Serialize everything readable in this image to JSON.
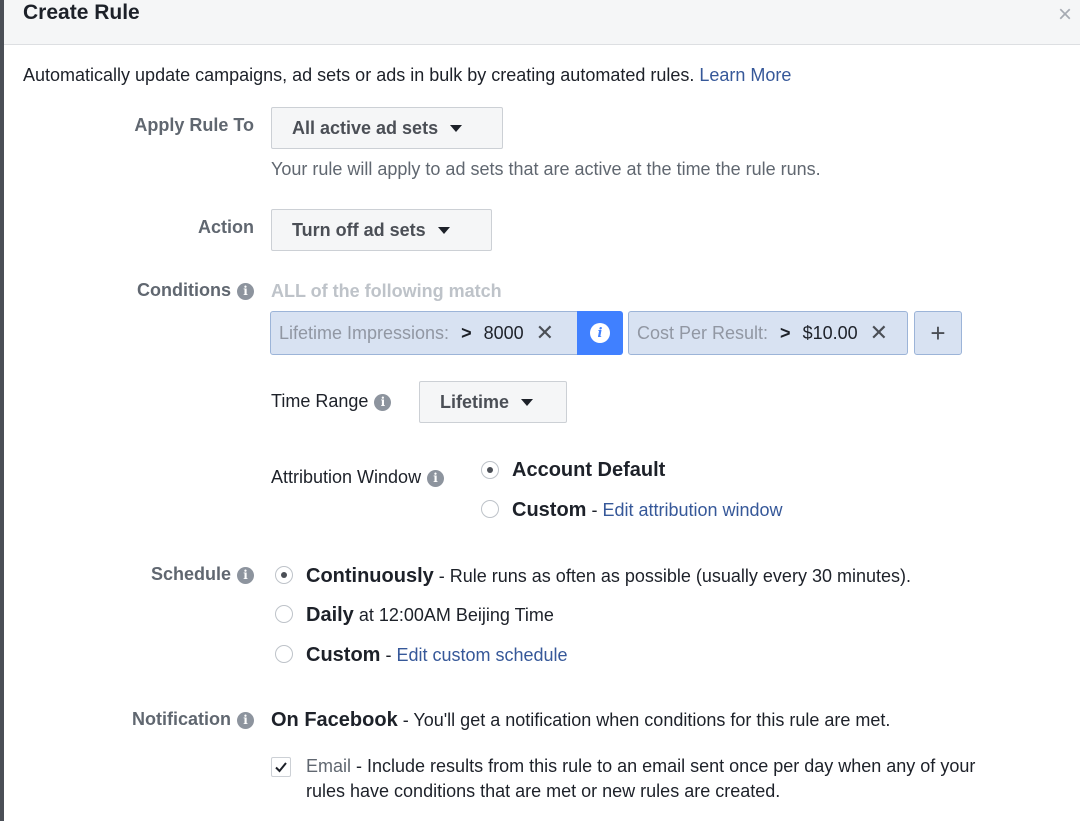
{
  "dialog": {
    "title": "Create Rule",
    "close_icon": "×",
    "intro": "Automatically update campaigns, ad sets or ads in bulk by creating automated rules.",
    "learn_more": "Learn More"
  },
  "apply_rule": {
    "label": "Apply Rule To",
    "value": "All active ad sets",
    "help": "Your rule will apply to ad sets that are active at the time the rule runs."
  },
  "action": {
    "label": "Action",
    "value": "Turn off ad sets"
  },
  "conditions": {
    "label": "Conditions",
    "header": "ALL of the following match",
    "items": [
      {
        "field": "Lifetime Impressions:",
        "op": ">",
        "value": "8000"
      },
      {
        "field": "Cost Per Result:",
        "op": ">",
        "value": "$10.00"
      }
    ],
    "add_label": "+",
    "time_range": {
      "label": "Time Range",
      "value": "Lifetime"
    },
    "attribution": {
      "label": "Attribution Window",
      "options": [
        {
          "title": "Account Default",
          "checked": true
        },
        {
          "title": "Custom",
          "sep": " - ",
          "link": "Edit attribution window",
          "checked": false
        }
      ]
    }
  },
  "schedule": {
    "label": "Schedule",
    "options": [
      {
        "title": "Continuously",
        "desc": " - Rule runs as often as possible (usually every 30 minutes).",
        "checked": true
      },
      {
        "title": "Daily",
        "desc": " at 12:00AM Beijing Time",
        "checked": false
      },
      {
        "title": "Custom",
        "sep": " - ",
        "link": "Edit custom schedule",
        "checked": false
      }
    ]
  },
  "notification": {
    "label": "Notification",
    "facebook_title": "On Facebook",
    "facebook_desc": " - You'll get a notification when conditions for this rule are met.",
    "email_label": "Email",
    "email_desc_1": " - Include results from this rule to an email sent once per day when any of your",
    "email_desc_2": "rules have conditions that are met or new rules are created.",
    "email_checked": true
  },
  "icons": {
    "info": "i",
    "caret": "caret-down",
    "check": "check"
  },
  "colors": {
    "link": "#365899",
    "accent": "#4080ff",
    "chip_bg": "#d8e2f2"
  }
}
